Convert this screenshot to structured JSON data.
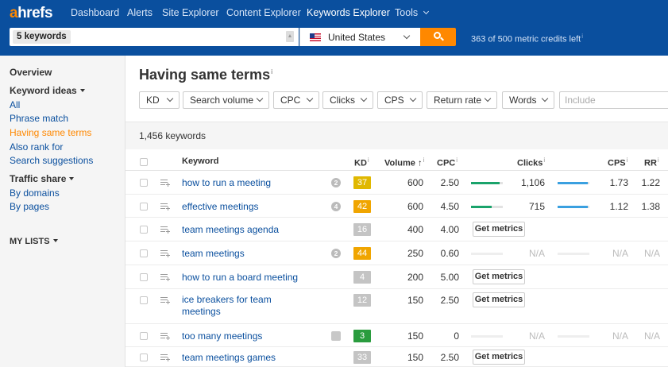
{
  "nav": {
    "logo_a": "a",
    "logo_rest": "hrefs",
    "items": [
      "Dashboard",
      "Alerts",
      "Site Explorer",
      "Content Explorer",
      "Keywords Explorer",
      "Tools"
    ],
    "active": "Keywords Explorer"
  },
  "search": {
    "chip": "5 keywords",
    "country": "United States",
    "credits": "363 of 500 metric credits left",
    "info": "i"
  },
  "sidebar": {
    "overview": "Overview",
    "keyword_ideas": "Keyword ideas",
    "ideas": [
      "All",
      "Phrase match",
      "Having same terms",
      "Also rank for",
      "Search suggestions"
    ],
    "active_idea": "Having same terms",
    "traffic_share": "Traffic share",
    "traffic": [
      "By domains",
      "By pages"
    ],
    "my_lists": "MY LISTS"
  },
  "main": {
    "title": "Having same terms",
    "filters": [
      "KD",
      "Search volume",
      "CPC",
      "Clicks",
      "CPS",
      "Return rate",
      "Words"
    ],
    "include_placeholder": "Include",
    "count": "1,456 keywords",
    "columns": {
      "keyword": "Keyword",
      "kd": "KD",
      "volume": "Volume",
      "cpc": "CPC",
      "clicks": "Clicks",
      "cps": "CPS",
      "rr": "RR"
    },
    "get_metrics": "Get metrics",
    "na": "N/A"
  },
  "colors": {
    "nav_bg": "#0a4f9e",
    "accent": "#ff8800",
    "link": "#0a4f9e",
    "kd_yellow": "#e0b800",
    "kd_orange": "#f0a500",
    "kd_gray": "#c4c4c4",
    "kd_green": "#2a9c3e",
    "bar_green": "#1aa36b",
    "bar_blue": "#3aa0e0"
  },
  "rows": [
    {
      "keyword": "how to run a meeting",
      "serp": "2",
      "serp_icon": "serp-count-icon",
      "kd": "37",
      "kd_color": "#e0b800",
      "volume": "600",
      "cpc": "2.50",
      "has_metrics": true,
      "paid_fraction": 0.9,
      "clicks": "1,106",
      "clicks_fraction": 0.95,
      "cps": "1.73",
      "rr": "1.22"
    },
    {
      "keyword": "effective meetings",
      "serp": "4",
      "serp_icon": "serp-count-icon",
      "kd": "42",
      "kd_color": "#f0a500",
      "volume": "600",
      "cpc": "4.50",
      "has_metrics": true,
      "paid_fraction": 0.65,
      "clicks": "715",
      "clicks_fraction": 0.95,
      "cps": "1.12",
      "rr": "1.38"
    },
    {
      "keyword": "team meetings agenda",
      "serp": "",
      "kd": "16",
      "kd_color": "#c4c4c4",
      "volume": "400",
      "cpc": "4.00",
      "has_metrics": false,
      "get_metrics": true
    },
    {
      "keyword": "team meetings",
      "serp": "2",
      "serp_icon": "serp-count-icon",
      "kd": "44",
      "kd_color": "#f0a500",
      "volume": "250",
      "cpc": "0.60",
      "has_metrics": false,
      "get_metrics": false
    },
    {
      "keyword": "how to run a board meeting",
      "serp": "",
      "kd": "4",
      "kd_color": "#c4c4c4",
      "volume": "200",
      "cpc": "5.00",
      "has_metrics": false,
      "get_metrics": true
    },
    {
      "keyword": "ice breakers for team meetings",
      "serp": "",
      "kd": "12",
      "kd_color": "#c4c4c4",
      "volume": "150",
      "cpc": "2.50",
      "has_metrics": false,
      "get_metrics": true
    },
    {
      "keyword": "too many meetings",
      "serp": "img",
      "serp_icon": "image-serp-icon",
      "kd": "3",
      "kd_color": "#2a9c3e",
      "volume": "150",
      "cpc": "0",
      "has_metrics": false,
      "get_metrics": false
    },
    {
      "keyword": "team meetings games",
      "serp": "",
      "kd": "33",
      "kd_color": "#c4c4c4",
      "volume": "150",
      "cpc": "2.50",
      "has_metrics": false,
      "get_metrics": true
    }
  ]
}
